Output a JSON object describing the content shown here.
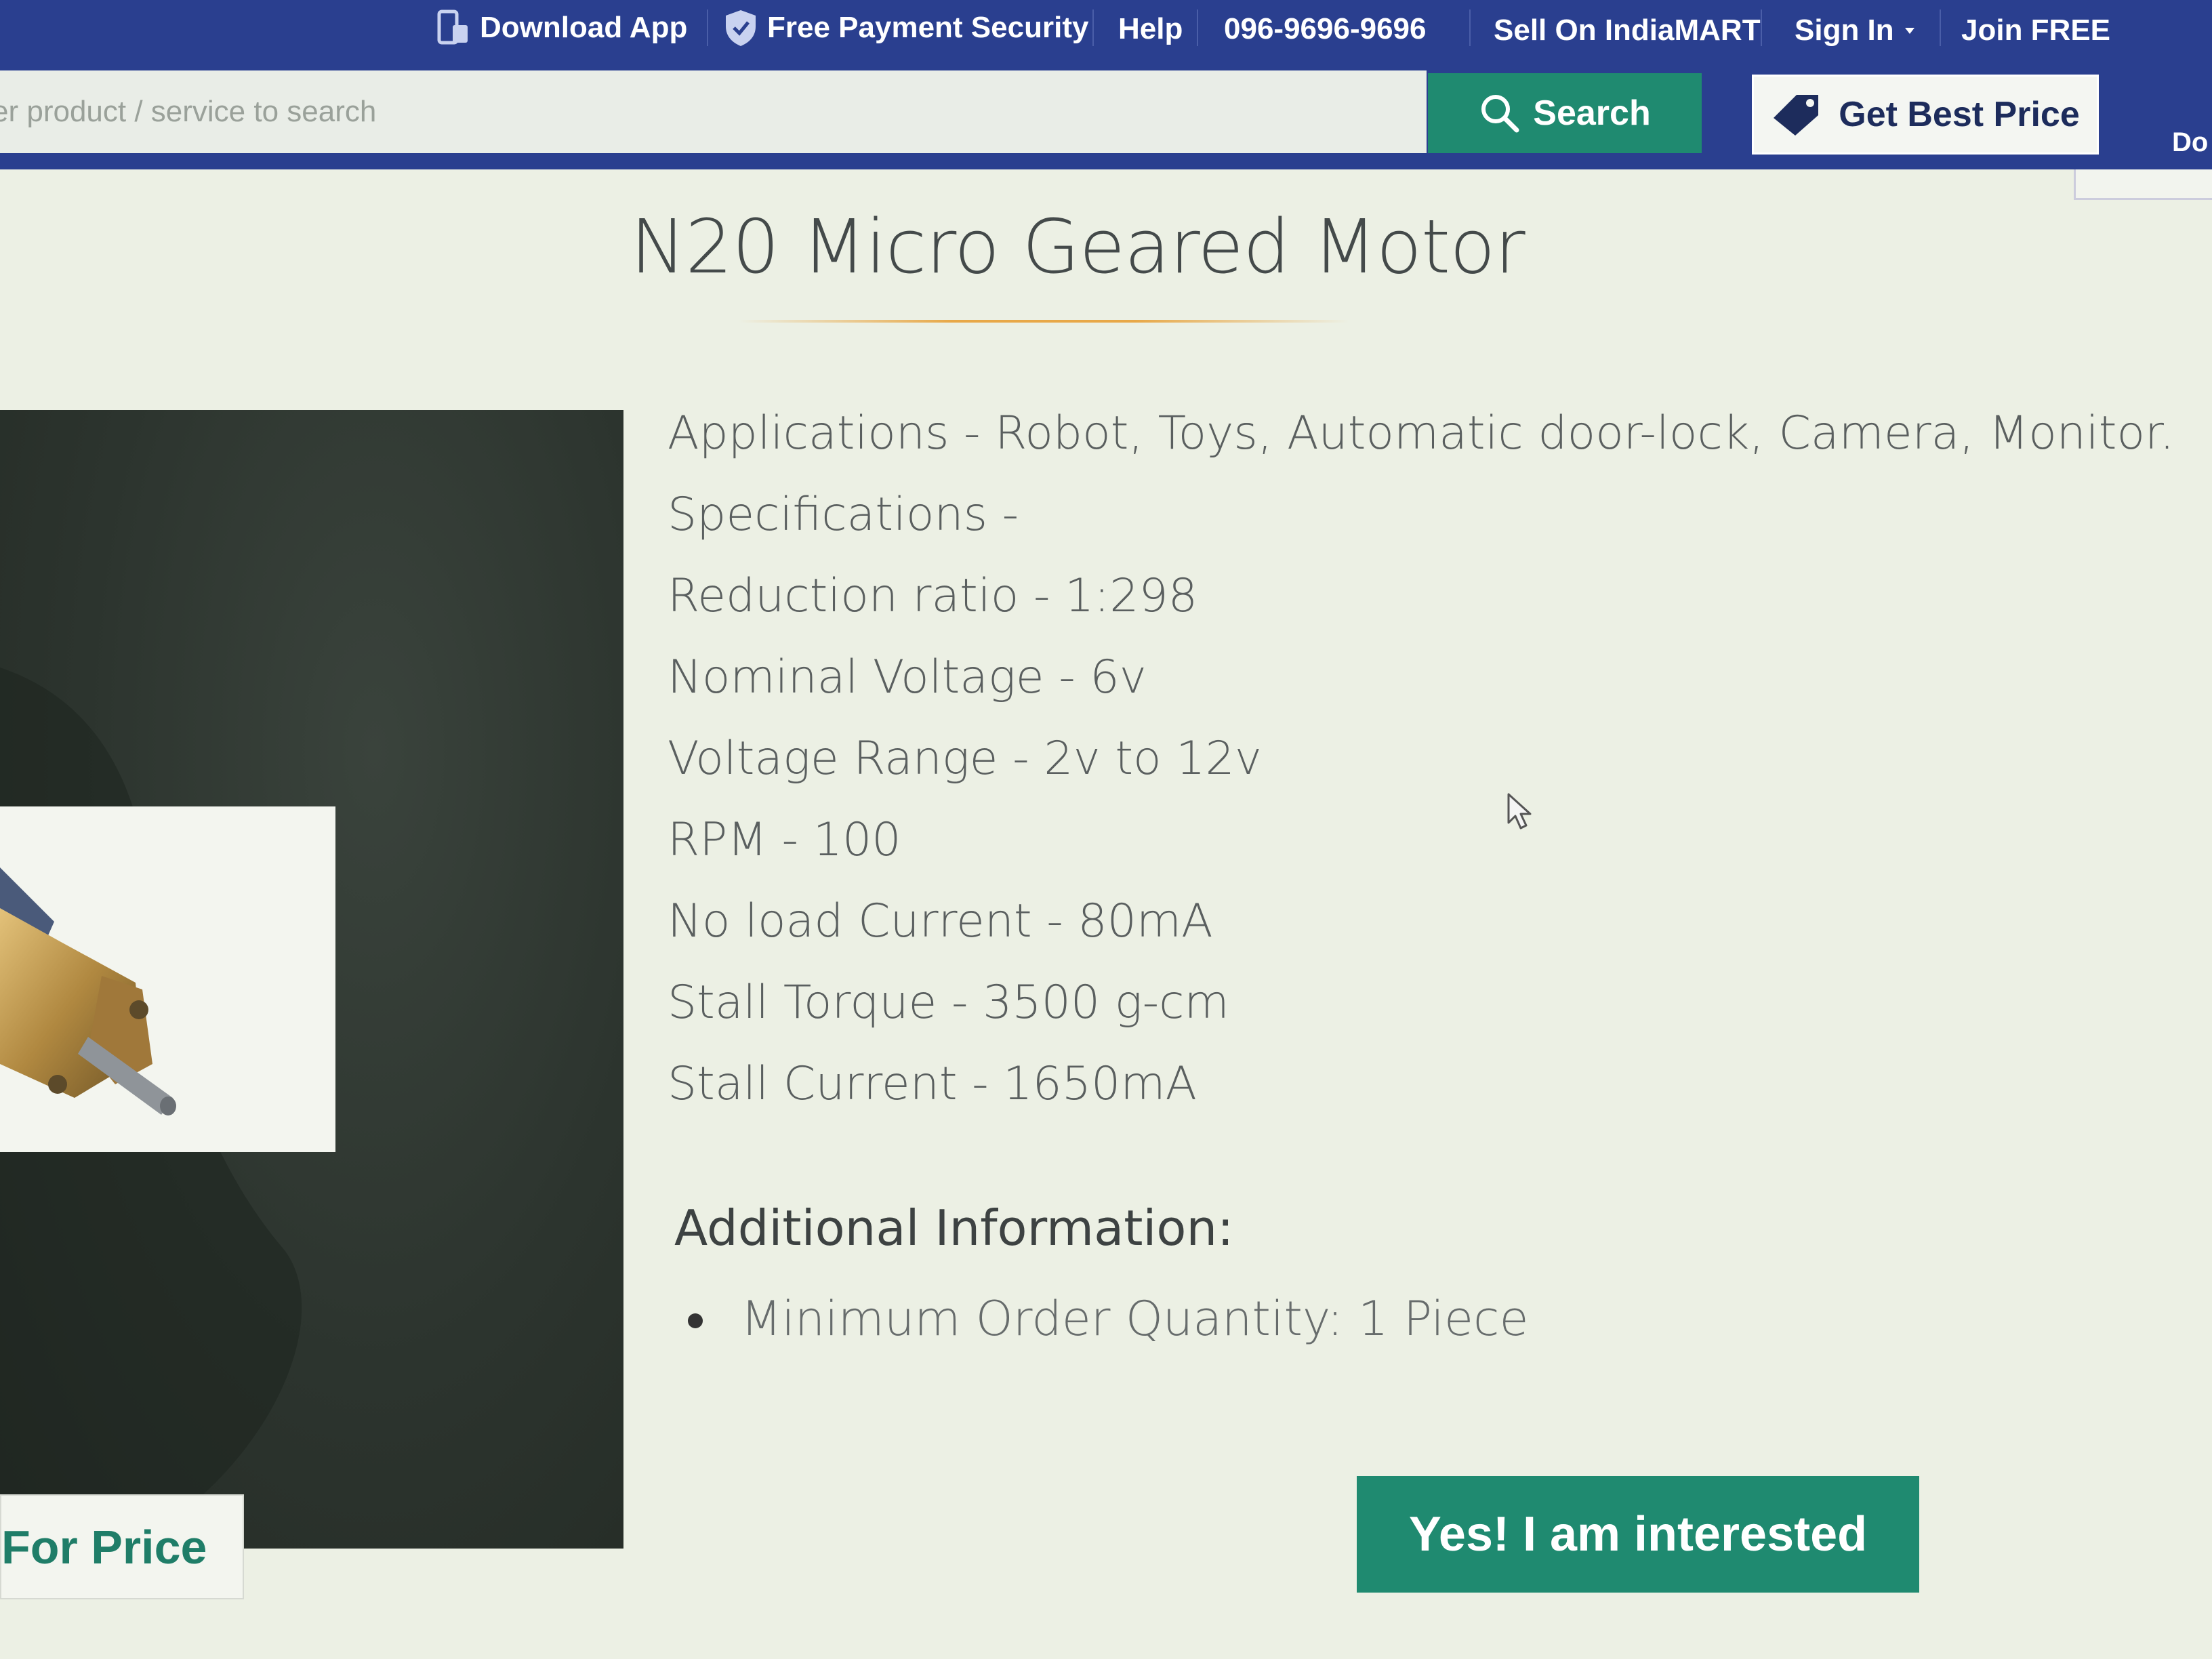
{
  "topnav": {
    "download_app": "Download App",
    "payment_security": "Free Payment Security",
    "help": "Help",
    "phone": "096-9696-9696",
    "sell": "Sell On IndiaMART",
    "sign_in": "Sign In",
    "join": "Join FREE"
  },
  "search": {
    "placeholder": "er product / service to search",
    "button_label": "Search"
  },
  "get_best_price_label": "Get Best Price",
  "corner_text": "Do",
  "product": {
    "title": "N20 Micro Geared Motor",
    "price_button_label": "For Price",
    "specs": [
      "Applications - Robot, Toys, Automatic door-lock, Camera, Monitor.",
      "Specifications -",
      "Reduction ratio - 1:298",
      "Nominal Voltage - 6v",
      "Voltage Range - 2v to 12v",
      "RPM - 100",
      "No load Current - 80mA",
      "Stall Torque - 3500 g-cm",
      "Stall Current - 1650mA"
    ],
    "additional_heading": "Additional Information:",
    "moq": "Minimum Order Quantity: 1 Piece"
  },
  "cta": {
    "interested_label": "Yes! I am interested"
  },
  "colors": {
    "nav_bg": "#2a3f8f",
    "accent_green": "#1f8a70",
    "title_rule": "#e8a848"
  }
}
